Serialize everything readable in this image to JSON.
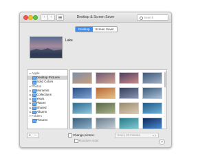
{
  "window": {
    "title": "Desktop & Screen Saver",
    "nav_back": "‹",
    "nav_forward": "›",
    "search_placeholder": "Search"
  },
  "tabs": [
    {
      "label": "Desktop",
      "active": true
    },
    {
      "label": "Screen Saver",
      "active": false
    }
  ],
  "preview": {
    "name": "Lake"
  },
  "sidebar": {
    "rows": [
      {
        "label": "Apple",
        "type": "header",
        "caret": "▼"
      },
      {
        "label": "Desktop Pictures",
        "type": "item",
        "selected": true
      },
      {
        "label": "Solid Colors",
        "type": "item",
        "selected": false
      },
      {
        "label": "Photos",
        "type": "header",
        "caret": "▼"
      },
      {
        "label": "Moments",
        "type": "item",
        "caret": "▶"
      },
      {
        "label": "Collections",
        "type": "item",
        "caret": "▶"
      },
      {
        "label": "Years",
        "type": "item",
        "caret": "▶"
      },
      {
        "label": "Places",
        "type": "item",
        "caret": "▶"
      },
      {
        "label": "Shared",
        "type": "item",
        "caret": "▶"
      },
      {
        "label": "Albums",
        "type": "item",
        "caret": "▶"
      },
      {
        "label": "Folders",
        "type": "header",
        "caret": "▼"
      },
      {
        "label": "Pictures",
        "type": "item"
      }
    ]
  },
  "thumbnails": [
    [
      "#7f8ca8",
      "#c9a07a"
    ],
    [
      "#6d5a78",
      "#d2a48e"
    ],
    [
      "#4e3f5c",
      "#c98a8a"
    ],
    [
      "#3f5a78",
      "#9fb0c3"
    ],
    [
      "#2b4f86",
      "#7fa3d1"
    ],
    [
      "#b86a38",
      "#e6c08a"
    ],
    [
      "#34405c",
      "#8a96b0"
    ],
    [
      "#3e5c7a",
      "#a9c0d6"
    ],
    [
      "#2e6a8f",
      "#8fc6dc"
    ],
    [
      "#5a6a4a",
      "#a8b08a"
    ],
    [
      "#9a8a70",
      "#dccbb0"
    ],
    [
      "#1f5a88",
      "#6fb0d8"
    ],
    [
      "#3c5f7d",
      "#8db1c9"
    ],
    [
      "#6b7c8a",
      "#c4cfd6"
    ],
    [
      "#2a7a8a",
      "#7ecad2"
    ],
    [
      "#0e2a5a",
      "#4a8ad0"
    ],
    [
      "#0b1a3a",
      "#3a6aa8"
    ],
    [
      "#0a2040",
      "#5a8ac8"
    ],
    [
      "#3a90c0",
      "#a0d4ec"
    ],
    [
      "#1a3a6a",
      "#6a9ad0"
    ],
    [
      "#888888",
      "#cccccc"
    ],
    [
      "#7a8a9a",
      "#c0c8d0"
    ],
    [
      "#9aa8b4",
      "#d4dbe0"
    ],
    [
      "#8a9aa8",
      "#c8d0d8"
    ]
  ],
  "options": {
    "add_label": "+",
    "remove_label": "–",
    "change_picture_label": "Change picture:",
    "interval_value": "Every 30 minutes",
    "random_order_label": "Random order",
    "help_label": "?"
  }
}
